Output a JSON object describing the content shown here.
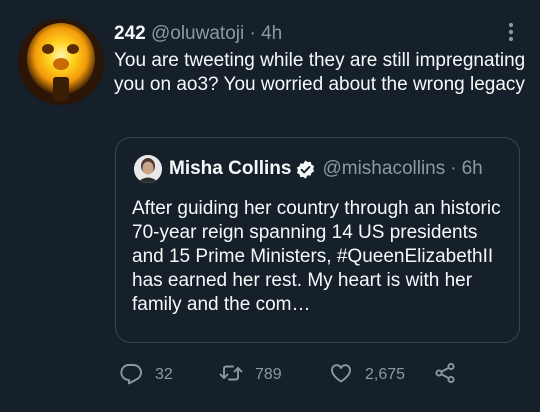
{
  "tweet": {
    "author_name": "242",
    "handle": "@oluwatoji",
    "separator": "·",
    "time": "4h",
    "text": "You are tweeting while they are still impregnating you on ao3? You worried about the wrong legacy"
  },
  "quoted": {
    "author_name": "Misha Collins",
    "handle": "@mishacollins",
    "separator": "·",
    "time": "6h",
    "text": "After guiding her country through an historic 70-year reign spanning 14 US presidents and 15 Prime Ministers, #QueenElizabethII has earned her rest. My heart is with her family and the com…"
  },
  "actions": {
    "replies": "32",
    "retweets": "789",
    "likes": "2,675"
  },
  "colors": {
    "background": "#15202b",
    "text": "#f7f9f9",
    "secondary": "#8b98a5",
    "border": "#38444d",
    "verified": "#1d9bf0"
  },
  "icons": [
    "avatar",
    "more-icon",
    "verified-badge-icon",
    "reply-icon",
    "retweet-icon",
    "like-icon",
    "share-icon"
  ]
}
